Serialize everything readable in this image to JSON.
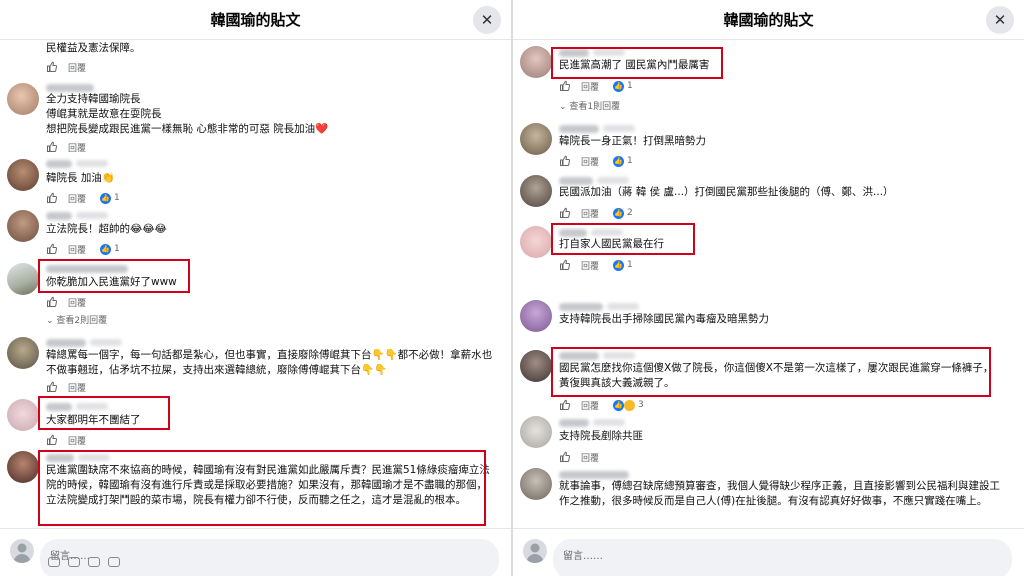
{
  "colors": {
    "highlight": "#d0021b",
    "like_blue": "#1877f2",
    "meta_gray": "#65676b"
  },
  "left": {
    "title": "韓國瑜的貼文",
    "close_icon": "✕",
    "comments": [
      {
        "text": "民權益及憲法保障。",
        "like": "讚",
        "reply": "回覆"
      },
      {
        "text": "全力支持韓國瑜院長\n傅崐萁就是故意在耍院長\n想把院長變成跟民進黨一樣無恥 心態非常的可惡 院長加油❤️",
        "like": "讚",
        "reply": "回覆"
      },
      {
        "text": "韓院長 加油👏",
        "like": "讚",
        "reply": "回覆",
        "reactions": "1"
      },
      {
        "text": "立法院長！超帥的😂😂😂",
        "like": "讚",
        "reply": "回覆",
        "reactions": "1"
      },
      {
        "text": "你乾脆加入民進黨好了www",
        "like": "讚",
        "reply": "回覆",
        "view_replies": "查看2則回覆"
      },
      {
        "text": "韓總罵每一個字，每一句話都是紮心，但也事實，直接廢除傅崐萁下台👇👇都不必做！拿薪水也不做事翹班，佔矛坑不拉屎，支持出來選韓總統，廢除傅傅崐萁下台👇👇",
        "like": "讚",
        "reply": "回覆"
      },
      {
        "text": "大家都明年不團結了",
        "like": "讚",
        "reply": "回覆"
      },
      {
        "text": "民進黨圍缺席不來協商的時候，韓國瑜有沒有對民進黨如此嚴厲斥責？民進黨51條綠痰瘤痺立法院的時候，韓國瑜有沒有進行斥責或是採取必要措施？如果沒有，那韓國瑜才是不盡職的那個，立法院變成打架鬥毆的菜市場，院長有權力卻不行使，反而聽之任之，這才是混亂的根本。"
      }
    ],
    "footer_placeholder": "留言……"
  },
  "right": {
    "title": "韓國瑜的貼文",
    "close_icon": "✕",
    "comments": [
      {
        "text": "民進黨高潮了 國民黨內鬥最厲害",
        "like": "讚",
        "reply": "回覆",
        "reactions": "1",
        "view_replies": "查看1則回覆"
      },
      {
        "text": "韓院長一身正氣！打倒黑暗勢力",
        "like": "讚",
        "reply": "回覆",
        "reactions": "1"
      },
      {
        "text": "民國派加油（蔣 韓 侯 盧...）打倒國民黨那些扯後腿的（傅、鄭、洪...）",
        "like": "讚",
        "reply": "回覆",
        "reactions": "2"
      },
      {
        "text": "打自家人國民黨最在行",
        "like": "讚",
        "reply": "回覆",
        "reactions": "1"
      },
      {
        "text": "支持韓院長出手掃除國民黨內毒瘤及暗黑勢力"
      },
      {
        "text": "國民黨怎麼找你這個傻X做了院長，你這個傻X不是第一次這樣了，屢次跟民進黨穿一條褲子，黃復興真該大義滅親了。",
        "like": "讚",
        "reply": "回覆",
        "reactions": "3"
      },
      {
        "text": "支持院長剷除共匪",
        "like": "讚",
        "reply": "回覆"
      },
      {
        "text": "就事論事，傅總召缺席總預算審查，我個人覺得缺少程序正義，且直接影響到公民福利與建設工作之推動，很多時候反而是自己人(傅)在扯後腿。有沒有認真好好做事，不應只實踐在嘴上。"
      }
    ],
    "footer_placeholder": "留言……"
  }
}
